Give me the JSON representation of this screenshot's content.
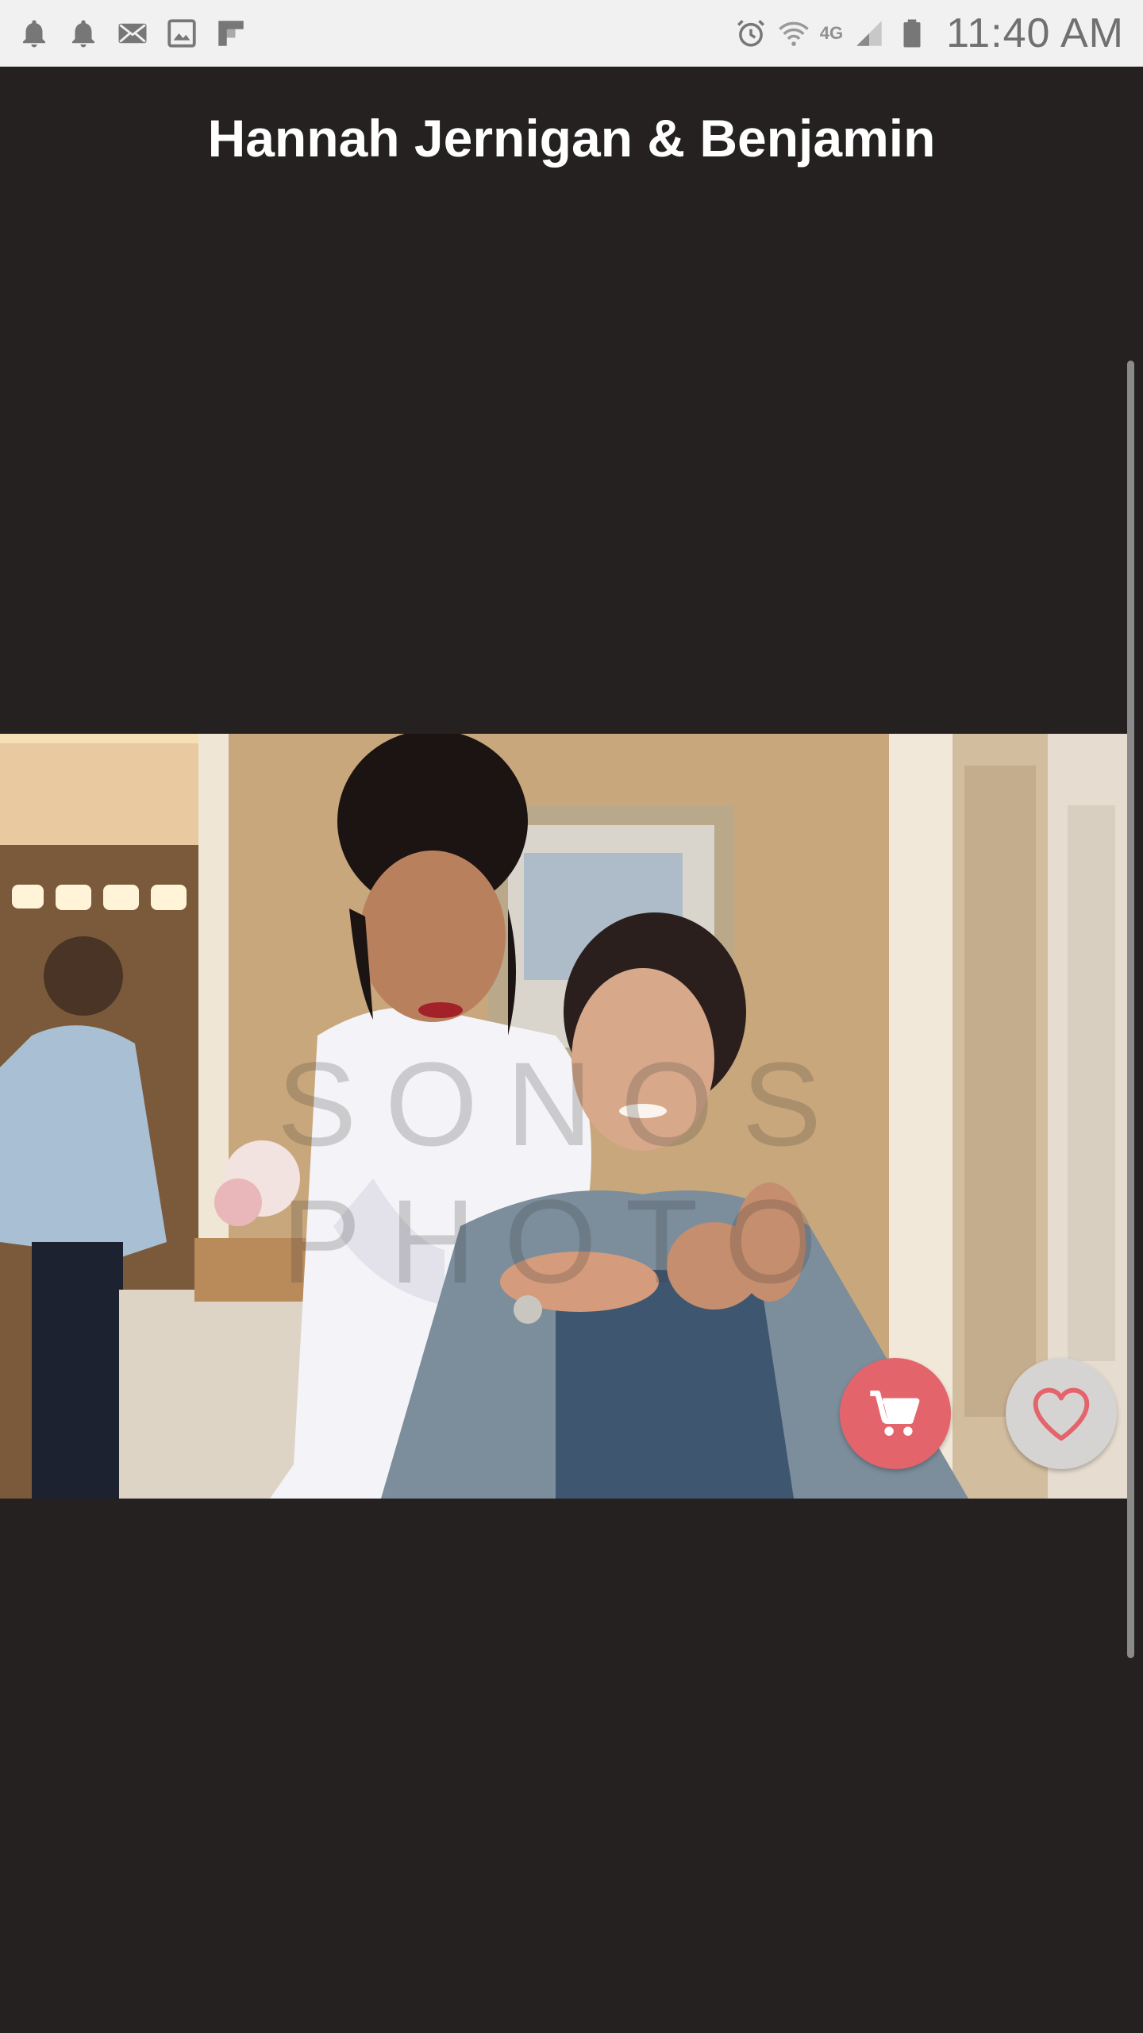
{
  "status_bar": {
    "left_icons": [
      "bell-icon",
      "bell-icon",
      "mail-icon",
      "image-icon",
      "flipboard-icon"
    ],
    "right_icons": [
      "alarm-icon",
      "wifi-icon",
      "signal-icon",
      "battery-icon"
    ],
    "network": "4G",
    "time": "11:40 AM"
  },
  "header": {
    "title": "Hannah Jernigan & Benjamin"
  },
  "photo": {
    "watermark": "SONOS PHOTO"
  },
  "actions": {
    "cart_icon": "cart-icon",
    "favorite_icon": "heart-icon",
    "cart_color": "#e4646c",
    "favorite_color": "#d6d4d3"
  },
  "colors": {
    "background": "#252120",
    "accent": "#e4646c"
  }
}
